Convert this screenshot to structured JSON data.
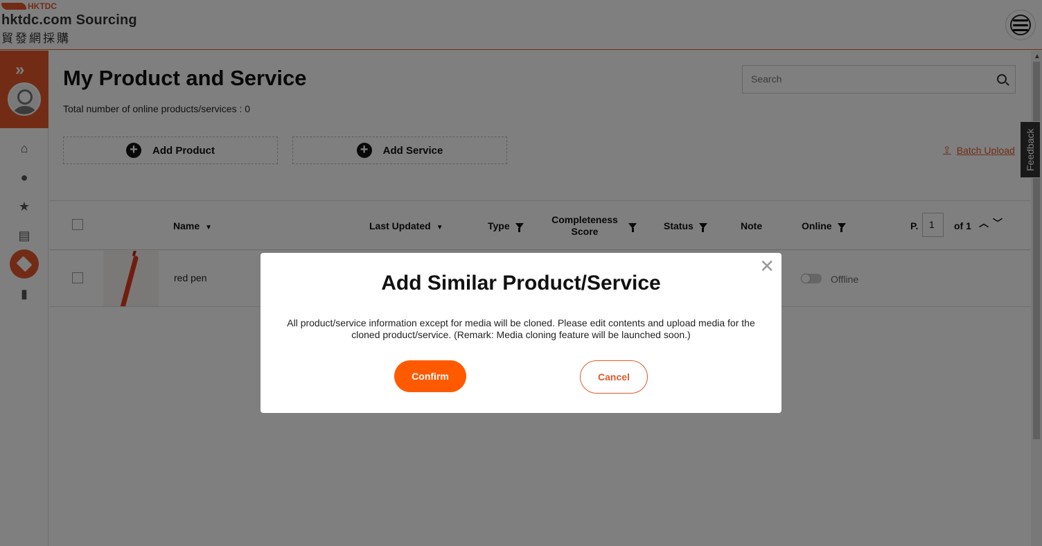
{
  "header": {
    "logo_hktdc": "HKTDC",
    "logo_title": "hktdc.com Sourcing",
    "logo_chinese": "貿發網採購"
  },
  "main": {
    "title": "My Product and Service",
    "total_text": "Total number of online products/services : 0",
    "search_placeholder": "Search",
    "add_product": "Add Product",
    "add_service": "Add Service",
    "batch_upload": "Batch Upload"
  },
  "table": {
    "headers": {
      "name": "Name",
      "last_updated": "Last Updated",
      "type": "Type",
      "completeness": "Completeness Score",
      "status": "Status",
      "note": "Note",
      "online": "Online"
    },
    "pagination": {
      "prefix": "P.",
      "page": "1",
      "of": "of 1"
    },
    "rows": [
      {
        "name": "red pen",
        "online_status": "Offline"
      }
    ]
  },
  "feedback": "Feedback",
  "modal": {
    "title": "Add Similar Product/Service",
    "text": "All product/service information except for media will be cloned. Please edit contents and upload media for the cloned product/service. (Remark: Media cloning feature will be launched soon.)",
    "confirm": "Confirm",
    "cancel": "Cancel"
  },
  "colors": {
    "brand": "#e4592a",
    "confirm": "#ff5a00"
  }
}
